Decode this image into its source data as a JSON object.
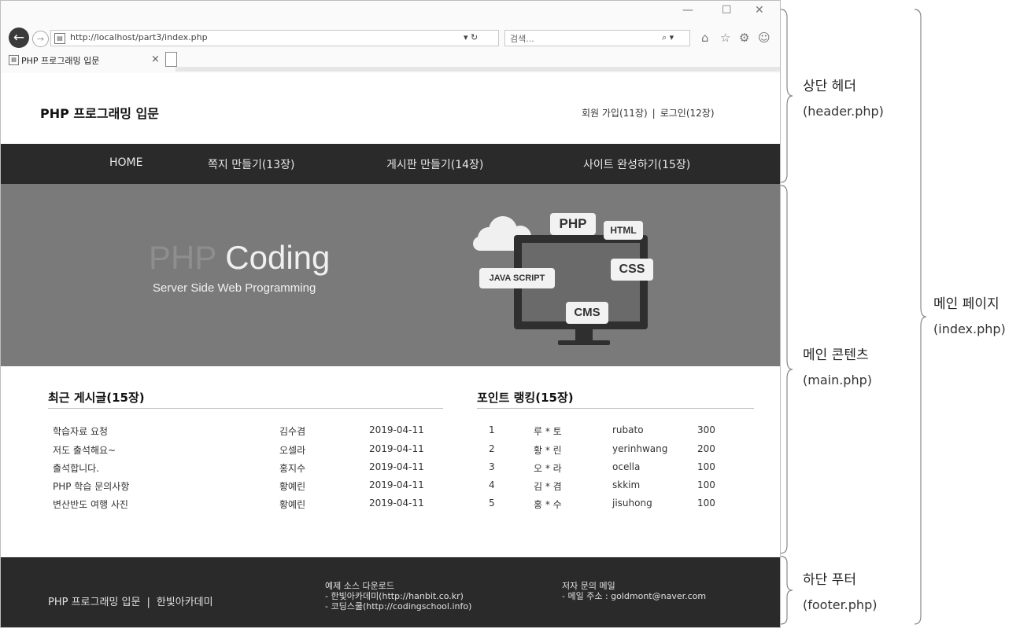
{
  "browser": {
    "url": "http://localhost/part3/index.php",
    "search_placeholder": "검색...",
    "tab_title": "PHP 프로그래밍 입문",
    "address_controls": "▾ ↻",
    "search_controls": "⌕ ▾",
    "window_controls": {
      "minimize": "—",
      "maximize": "☐",
      "close": "✕"
    },
    "tab_close": "×"
  },
  "header": {
    "site_title": "PHP 프로그래밍 입문",
    "join": "회원 가입(11장)",
    "login": "로그인(12장)",
    "separator": "|"
  },
  "nav": [
    "HOME",
    "쪽지 만들기(13장)",
    "게시판 만들기(14장)",
    "사이트 완성하기(15장)"
  ],
  "banner": {
    "title_php": "PHP",
    "title_coding": "Coding",
    "subtitle": "Server Side Web Programming",
    "tags": [
      "PHP",
      "HTML",
      "CSS",
      "JAVA SCRIPT",
      "CMS"
    ]
  },
  "recent": {
    "title": "최근 게시글(15장)",
    "rows": [
      {
        "subject": "학습자료 요청",
        "name": "김수겸",
        "date": "2019-04-11"
      },
      {
        "subject": "저도 출석해요~",
        "name": "오셀라",
        "date": "2019-04-11"
      },
      {
        "subject": "출석합니다.",
        "name": "홍지수",
        "date": "2019-04-11"
      },
      {
        "subject": "PHP 학습 문의사항",
        "name": "황예린",
        "date": "2019-04-11"
      },
      {
        "subject": "변산반도 여행 사진",
        "name": "황예린",
        "date": "2019-04-11"
      }
    ]
  },
  "ranking": {
    "title": "포인트 랭킹(15장)",
    "rows": [
      {
        "no": "1",
        "name": "루 * 토",
        "id": "rubato",
        "point": "300"
      },
      {
        "no": "2",
        "name": "황 * 린",
        "id": "yerinhwang",
        "point": "200"
      },
      {
        "no": "3",
        "name": "오 * 라",
        "id": "ocella",
        "point": "100"
      },
      {
        "no": "4",
        "name": "김 * 겸",
        "id": "skkim",
        "point": "100"
      },
      {
        "no": "5",
        "name": "홍 * 수",
        "id": "jisuhong",
        "point": "100"
      }
    ]
  },
  "footer": {
    "copy_title": "PHP 프로그래밍 입문",
    "copy_org": "한빛아카데미",
    "separator": "|",
    "download": {
      "title": "예제 소스 다운로드",
      "line1": "- 한빛아카데미(http://hanbit.co.kr)",
      "line2": "- 코딩스쿨(http://codingschool.info)"
    },
    "contact": {
      "title": "저자 문의 메일",
      "line1": "- 메일 주소 : goldmont@naver.com"
    }
  },
  "annotations": {
    "header_label": "상단 헤더",
    "header_file": "(header.php)",
    "main_label": "메인 콘텐츠",
    "main_file": "(main.php)",
    "footer_label": "하단 푸터",
    "footer_file": "(footer.php)",
    "page_label": "메인 페이지",
    "page_file": "(index.php)"
  },
  "colors": {
    "nav_bg": "#2a2a2a",
    "banner_bg": "#7a7a7a",
    "footer_bg": "#2a2a2a"
  }
}
